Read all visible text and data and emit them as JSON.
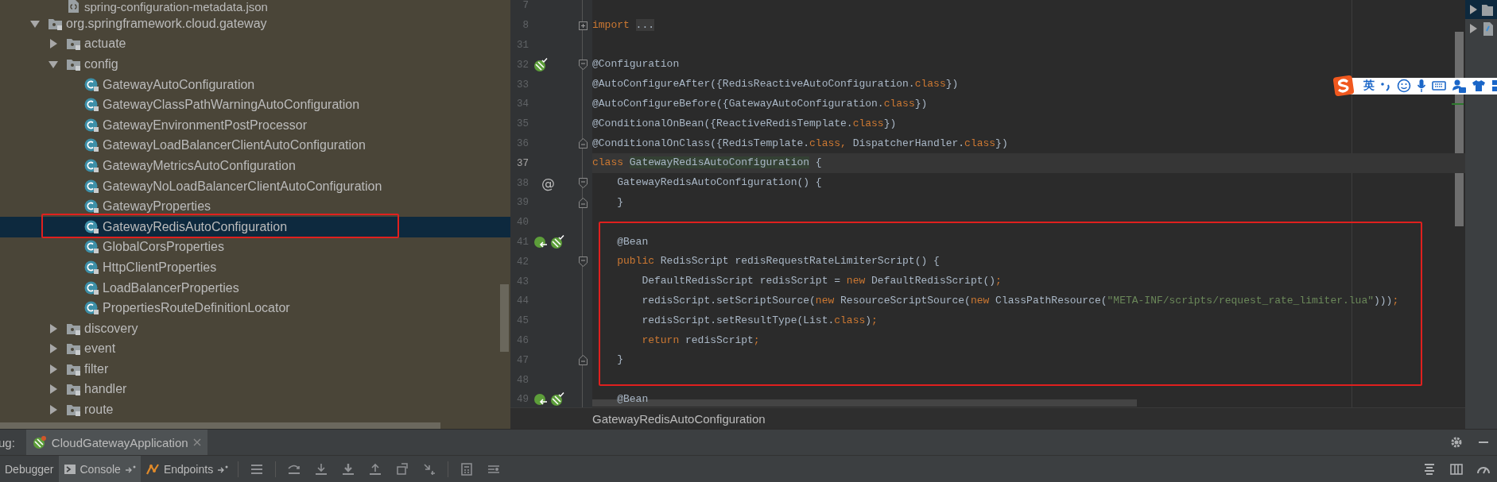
{
  "project_tree": {
    "partial_row": {
      "label": "spring-configuration-metadata.json",
      "kind": "json"
    },
    "items": [
      {
        "label": "org.springframework.cloud.gateway",
        "kind": "package",
        "expanded": true,
        "selected": false,
        "children": [
          {
            "label": "actuate",
            "kind": "package",
            "expanded": false,
            "selected": false
          },
          {
            "label": "config",
            "kind": "package",
            "expanded": true,
            "selected": false,
            "children": [
              {
                "label": "GatewayAutoConfiguration",
                "kind": "class",
                "selected": false
              },
              {
                "label": "GatewayClassPathWarningAutoConfiguration",
                "kind": "class",
                "selected": false
              },
              {
                "label": "GatewayEnvironmentPostProcessor",
                "kind": "class",
                "selected": false
              },
              {
                "label": "GatewayLoadBalancerClientAutoConfiguration",
                "kind": "class",
                "selected": false
              },
              {
                "label": "GatewayMetricsAutoConfiguration",
                "kind": "class",
                "selected": false
              },
              {
                "label": "GatewayNoLoadBalancerClientAutoConfiguration",
                "kind": "class",
                "selected": false
              },
              {
                "label": "GatewayProperties",
                "kind": "class",
                "selected": false
              },
              {
                "label": "GatewayRedisAutoConfiguration",
                "kind": "class",
                "selected": true
              },
              {
                "label": "GlobalCorsProperties",
                "kind": "class",
                "selected": false
              },
              {
                "label": "HttpClientProperties",
                "kind": "class",
                "selected": false
              },
              {
                "label": "LoadBalancerProperties",
                "kind": "class",
                "selected": false
              },
              {
                "label": "PropertiesRouteDefinitionLocator",
                "kind": "class",
                "selected": false
              }
            ]
          },
          {
            "label": "discovery",
            "kind": "package",
            "expanded": false,
            "selected": false
          },
          {
            "label": "event",
            "kind": "package",
            "expanded": false,
            "selected": false
          },
          {
            "label": "filter",
            "kind": "package",
            "expanded": false,
            "selected": false
          },
          {
            "label": "handler",
            "kind": "package",
            "expanded": false,
            "selected": false
          },
          {
            "label": "route",
            "kind": "package",
            "expanded": false,
            "selected": false
          }
        ]
      }
    ]
  },
  "editor": {
    "lines": [
      {
        "number": "7",
        "current": false
      },
      {
        "number": "8",
        "current": false,
        "fold": {
          "kind": "plus"
        },
        "tokens": [
          {
            "kind": "keyword",
            "text": "import "
          },
          {
            "kind": "folded",
            "text": "..."
          }
        ]
      },
      {
        "number": "31",
        "current": false
      },
      {
        "number": "32",
        "current": false,
        "gutter": [
          {
            "kind": "bean"
          }
        ],
        "fold": {
          "kind": "open"
        },
        "tokens": [
          {
            "kind": "plain",
            "text": "@Configuration"
          }
        ]
      },
      {
        "number": "33",
        "current": false,
        "tokens": [
          {
            "kind": "plain",
            "text": "@AutoConfigureAfter({RedisReactiveAutoConfiguration."
          },
          {
            "kind": "keyword",
            "text": "class"
          },
          {
            "kind": "plain",
            "text": "})"
          }
        ]
      },
      {
        "number": "34",
        "current": false,
        "tokens": [
          {
            "kind": "plain",
            "text": "@AutoConfigureBefore({GatewayAutoConfiguration."
          },
          {
            "kind": "keyword",
            "text": "class"
          },
          {
            "kind": "plain",
            "text": "})"
          }
        ]
      },
      {
        "number": "35",
        "current": false,
        "tokens": [
          {
            "kind": "plain",
            "text": "@ConditionalOnBean({ReactiveRedisTemplate."
          },
          {
            "kind": "keyword",
            "text": "class"
          },
          {
            "kind": "plain",
            "text": "})"
          }
        ]
      },
      {
        "number": "36",
        "current": false,
        "fold": {
          "kind": "close"
        },
        "tokens": [
          {
            "kind": "plain",
            "text": "@ConditionalOnClass({RedisTemplate."
          },
          {
            "kind": "keyword",
            "text": "class,"
          },
          {
            "kind": "plain",
            "text": " DispatcherHandler."
          },
          {
            "kind": "keyword",
            "text": "class"
          },
          {
            "kind": "plain",
            "text": "})"
          }
        ]
      },
      {
        "number": "37",
        "current": true,
        "tokens": [
          {
            "kind": "keyword",
            "text": "class "
          },
          {
            "kind": "usage",
            "text": "GatewayRedisAutoConfiguration"
          },
          {
            "kind": "plain",
            "text": " {"
          }
        ]
      },
      {
        "number": "38",
        "current": false,
        "gutter_text": "@",
        "fold": {
          "kind": "open"
        },
        "tokens": [
          {
            "kind": "plain",
            "text": "    GatewayRedisAutoConfiguration() {"
          }
        ]
      },
      {
        "number": "39",
        "current": false,
        "fold": {
          "kind": "close"
        },
        "tokens": [
          {
            "kind": "plain",
            "text": "    }"
          }
        ]
      },
      {
        "number": "40",
        "current": false
      },
      {
        "number": "41",
        "current": false,
        "gutter": [
          {
            "kind": "bean-method"
          },
          {
            "kind": "bean"
          }
        ],
        "tokens": [
          {
            "kind": "plain",
            "text": "    @Bean"
          }
        ]
      },
      {
        "number": "42",
        "current": false,
        "fold": {
          "kind": "open"
        },
        "tokens": [
          {
            "kind": "keyword",
            "text": "    public"
          },
          {
            "kind": "plain",
            "text": " RedisScript redisRequestRateLimiterScript() {"
          }
        ]
      },
      {
        "number": "43",
        "current": false,
        "tokens": [
          {
            "kind": "plain",
            "text": "        DefaultRedisScript redisScript = "
          },
          {
            "kind": "keyword",
            "text": "new"
          },
          {
            "kind": "plain",
            "text": " DefaultRedisScript()"
          },
          {
            "kind": "keyword",
            "text": ";"
          }
        ]
      },
      {
        "number": "44",
        "current": false,
        "tokens": [
          {
            "kind": "plain",
            "text": "        redisScript.setScriptSource("
          },
          {
            "kind": "keyword",
            "text": "new"
          },
          {
            "kind": "plain",
            "text": " ResourceScriptSource("
          },
          {
            "kind": "keyword",
            "text": "new"
          },
          {
            "kind": "plain",
            "text": " ClassPathResource("
          },
          {
            "kind": "string",
            "text": "\"META-INF/scripts/request_rate_limiter.lua\""
          },
          {
            "kind": "plain",
            "text": ")))"
          },
          {
            "kind": "keyword",
            "text": ";"
          }
        ]
      },
      {
        "number": "45",
        "current": false,
        "tokens": [
          {
            "kind": "plain",
            "text": "        redisScript.setResultType(List."
          },
          {
            "kind": "keyword",
            "text": "class"
          },
          {
            "kind": "plain",
            "text": ")"
          },
          {
            "kind": "keyword",
            "text": ";"
          }
        ]
      },
      {
        "number": "46",
        "current": false,
        "tokens": [
          {
            "kind": "keyword",
            "text": "        return"
          },
          {
            "kind": "plain",
            "text": " redisScript"
          },
          {
            "kind": "keyword",
            "text": ";"
          }
        ]
      },
      {
        "number": "47",
        "current": false,
        "fold": {
          "kind": "close"
        },
        "tokens": [
          {
            "kind": "plain",
            "text": "    }"
          }
        ]
      },
      {
        "number": "48",
        "current": false
      },
      {
        "number": "49",
        "current": false,
        "gutter": [
          {
            "kind": "bean-method"
          },
          {
            "kind": "bean"
          }
        ],
        "tokens": [
          {
            "kind": "plain",
            "text": "    @Bean"
          }
        ]
      }
    ],
    "breadcrumb": "GatewayRedisAutoConfiguration"
  },
  "ime_bar": {
    "mode": "英"
  },
  "debug_panel": {
    "title": "ug:",
    "tabs": [
      {
        "label": "CloudGatewayApplication",
        "selected": true
      }
    ],
    "tool_tabs": [
      {
        "label": "Debugger",
        "kind": "plain",
        "selected": false
      },
      {
        "label": "Console",
        "kind": "console",
        "selected": true
      },
      {
        "label": "Endpoints",
        "kind": "endpoints",
        "selected": false
      }
    ]
  }
}
